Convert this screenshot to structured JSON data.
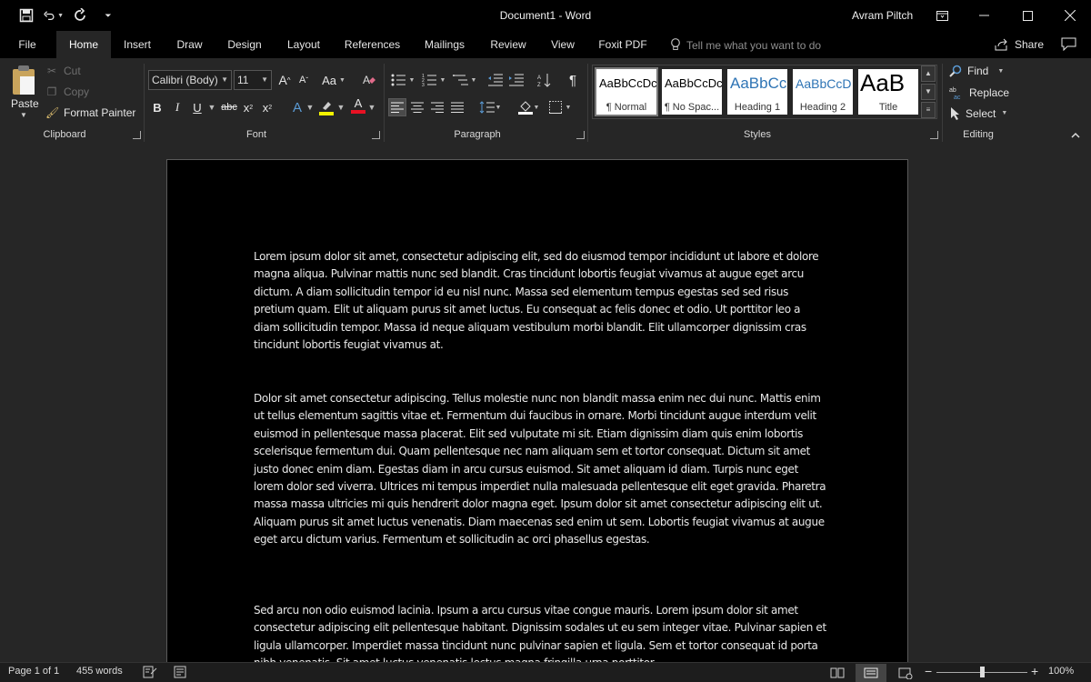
{
  "window": {
    "title": "Document1  -  Word",
    "user": "Avram Piltch",
    "quick_access": [
      "save-icon",
      "undo-icon",
      "redo-icon",
      "customize-qat-icon"
    ]
  },
  "tabs": [
    "File",
    "Home",
    "Insert",
    "Draw",
    "Design",
    "Layout",
    "References",
    "Mailings",
    "Review",
    "View",
    "Foxit PDF"
  ],
  "active_tab": "Home",
  "tell_me": {
    "placeholder": "Tell me what you want to do"
  },
  "share_label": "Share",
  "ribbon": {
    "clipboard": {
      "label": "Clipboard",
      "paste": "Paste",
      "cut": "Cut",
      "copy": "Copy",
      "format_painter": "Format Painter"
    },
    "font": {
      "label": "Font",
      "family": "Calibri (Body)",
      "size": "11",
      "change_case": "Aa",
      "bold": "B",
      "italic": "I",
      "underline": "U",
      "strike": "abc",
      "subscript": "x",
      "superscript": "x",
      "text_effects": "A",
      "font_color": "A",
      "grow": "A",
      "shrink": "A",
      "highlight_color": "#f3f300",
      "font_color_value": "#e81123"
    },
    "paragraph": {
      "label": "Paragraph"
    },
    "styles": {
      "label": "Styles",
      "items": [
        {
          "preview": "AaBbCcDc",
          "name": "¶ Normal"
        },
        {
          "preview": "AaBbCcDc",
          "name": "¶ No Spac..."
        },
        {
          "preview": "AaBbCc",
          "name": "Heading 1"
        },
        {
          "preview": "AaBbCcD",
          "name": "Heading 2"
        },
        {
          "preview": "AaB",
          "name": "Title"
        }
      ]
    },
    "editing": {
      "label": "Editing",
      "find": "Find",
      "replace": "Replace",
      "select": "Select"
    }
  },
  "document": {
    "paragraphs": [
      "Lorem ipsum dolor sit amet, consectetur adipiscing elit, sed do eiusmod tempor incididunt ut labore et dolore magna aliqua. Pulvinar mattis nunc sed blandit. Cras tincidunt lobortis feugiat vivamus at augue eget arcu dictum. A diam sollicitudin tempor id eu nisl nunc. Massa sed elementum tempus egestas sed sed risus pretium quam. Elit ut aliquam purus sit amet luctus. Eu consequat ac felis donec et odio. Ut porttitor leo a diam sollicitudin tempor. Massa id neque aliquam vestibulum morbi blandit. Elit ullamcorper dignissim cras tincidunt lobortis feugiat vivamus at.",
      "Dolor sit amet consectetur adipiscing. Tellus molestie nunc non blandit massa enim nec dui nunc. Mattis enim ut tellus elementum sagittis vitae et. Fermentum dui faucibus in ornare. Morbi tincidunt augue interdum velit euismod in pellentesque massa placerat. Elit sed vulputate mi sit. Etiam dignissim diam quis enim lobortis scelerisque fermentum dui. Quam pellentesque nec nam aliquam sem et tortor consequat. Dictum sit amet justo donec enim diam. Egestas diam in arcu cursus euismod. Sit amet aliquam id diam. Turpis nunc eget lorem dolor sed viverra. Ultrices mi tempus imperdiet nulla malesuada pellentesque elit eget gravida. Pharetra massa massa ultricies mi quis hendrerit dolor magna eget. Ipsum dolor sit amet consectetur adipiscing elit ut. Aliquam purus sit amet luctus venenatis. Diam maecenas sed enim ut sem. Lobortis feugiat vivamus at augue eget arcu dictum varius. Fermentum et sollicitudin ac orci phasellus egestas.",
      "Sed arcu non odio euismod lacinia. Ipsum a arcu cursus vitae congue mauris. Lorem ipsum dolor sit amet consectetur adipiscing elit pellentesque habitant. Dignissim sodales ut eu sem integer vitae. Pulvinar sapien et ligula ullamcorper. Imperdiet massa tincidunt nunc pulvinar sapien et ligula. Sem et tortor consequat id porta nibh venenatis. Sit amet luctus venenatis lectus magna fringilla urna porttitor."
    ]
  },
  "status": {
    "page": "Page 1 of 1",
    "words": "455 words",
    "zoom": "100%",
    "zoom_fraction": 0.5
  },
  "colors": {
    "ribbon_bg": "#262626",
    "page_bg": "#000000",
    "title_bg": "#000000"
  }
}
